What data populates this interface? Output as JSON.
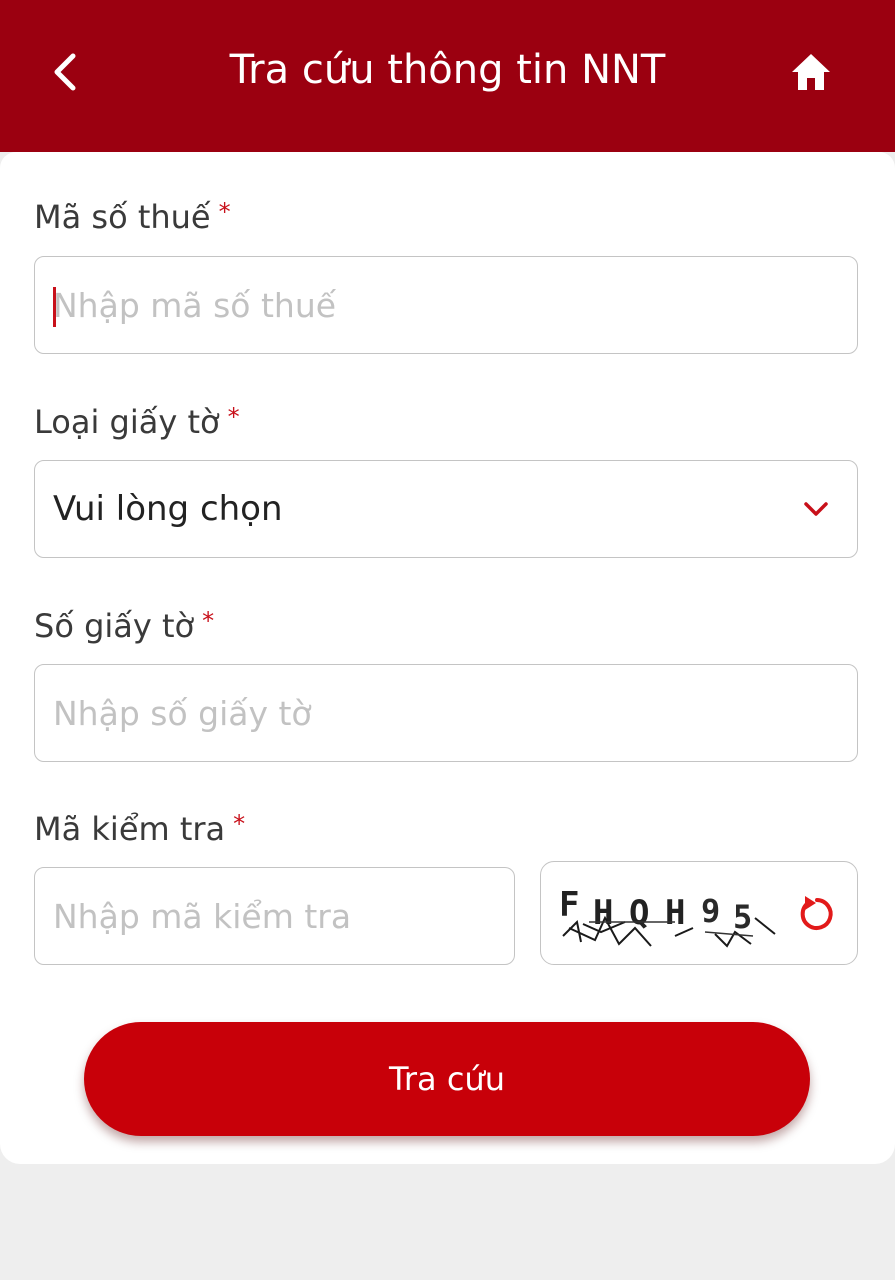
{
  "header": {
    "title": "Tra cứu thông tin NNT",
    "back_icon": "chevron-left-icon",
    "home_icon": "home-icon",
    "background_color": "#9b0010"
  },
  "form": {
    "required_mark": "*",
    "tax_code": {
      "label": "Mã số thuế",
      "placeholder": "Nhập mã số thuế",
      "value": ""
    },
    "document_type": {
      "label": "Loại giấy tờ",
      "selected": "Vui lòng chọn",
      "dropdown_icon": "chevron-down-icon"
    },
    "document_number": {
      "label": "Số giấy tờ",
      "placeholder": "Nhập số giấy tờ",
      "value": ""
    },
    "captcha": {
      "label": "Mã kiểm tra",
      "placeholder": "Nhập mã kiểm tra",
      "value": "",
      "image_text": "FHQH95",
      "refresh_icon": "refresh-icon"
    },
    "submit_label": "Tra cứu"
  },
  "colors": {
    "accent": "#c80009",
    "required": "#c8101a"
  }
}
